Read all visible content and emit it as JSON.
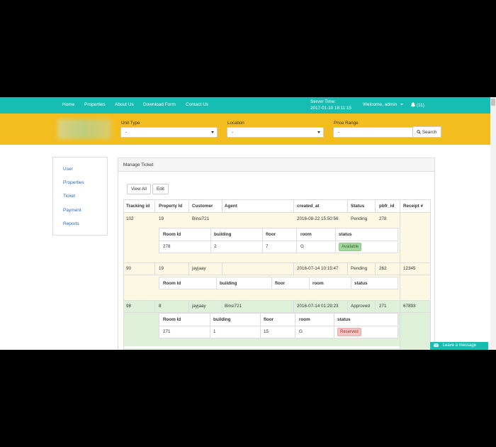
{
  "nav": {
    "links": [
      "Home",
      "Properties",
      "About Us",
      "Download Form",
      "Contact Us"
    ],
    "server_label": "Server Time:",
    "server_time": "2017-01-10 18:11:15",
    "welcome": "Welcome, admin",
    "notifications": "(11)"
  },
  "filters": {
    "unit_type_label": "Unit Type",
    "unit_type_value": "-",
    "location_label": "Location",
    "location_value": "-",
    "price_range_label": "Price Range",
    "price_range_value": "-",
    "search_label": "Search"
  },
  "sidebar": {
    "items": [
      "User",
      "Properties",
      "Ticket",
      "Payment",
      "Reports"
    ]
  },
  "panel": {
    "title": "Manage Ticket",
    "view_all": "View All",
    "edit": "Edit",
    "columns": [
      "Tracking id",
      "Property Id",
      "Customer",
      "Agent",
      "created_at",
      "Status",
      "pbfr_id",
      "Receipt #"
    ],
    "sub_columns": [
      "Room Id",
      "building",
      "floor",
      "room",
      "status"
    ],
    "rows": [
      {
        "tracking": "102",
        "property": "19",
        "customer": "Binsi721",
        "agent": "",
        "created": "2016-08-22 15:50:56",
        "status": "Pending",
        "pbfr": "278",
        "receipt": "",
        "room": {
          "room_id": "278",
          "building": "2",
          "floor": "7",
          "room": "G",
          "status": "Available"
        }
      },
      {
        "tracking": "90",
        "property": "19",
        "customer": "jayjaay",
        "agent": "",
        "created": "2016-07-14 10:15:47",
        "status": "Pending",
        "pbfr": "262",
        "receipt": "12345"
      },
      {
        "tracking": "98",
        "property": "8",
        "customer": "jayjaay",
        "agent": "Binsi721",
        "created": "2016-07-14 01:29:23",
        "status": "Approved",
        "pbfr": "271",
        "receipt": "67893",
        "room": {
          "room_id": "271",
          "building": "1",
          "floor": "15",
          "room": "G",
          "status": "Reserved"
        }
      }
    ]
  },
  "chat_label": "Leave a message",
  "colors": {
    "navbar": "#17bcb3",
    "searchbar": "#f4bd1f",
    "pending_row": "#fcf8e3",
    "approved_row": "#dff0d8"
  }
}
